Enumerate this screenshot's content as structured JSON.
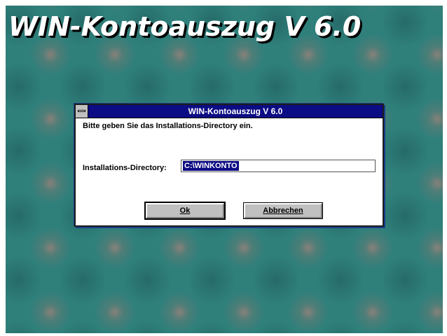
{
  "background": {
    "title": "WIN-Kontoauszug V 6.0"
  },
  "dialog": {
    "title": "WIN-Kontoauszug V 6.0",
    "prompt": "Bitte geben Sie das Installations-Directory ein.",
    "directory_label": "Installations-Directory:",
    "directory_value": "C:\\WINKONTO",
    "ok_label": "Ok",
    "cancel_label": "Abbrechen"
  },
  "colors": {
    "desktop": "#2f7f7b",
    "titlebar": "#0c0c84",
    "button_face": "#c0c0c0",
    "selection": "#0c0c84"
  }
}
